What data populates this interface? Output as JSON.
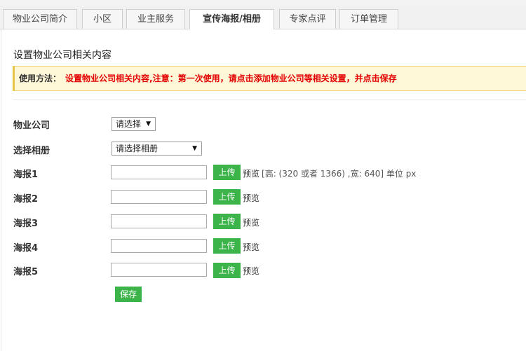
{
  "tabs": [
    {
      "label": "物业公司简介",
      "active": false
    },
    {
      "label": "小区",
      "active": false
    },
    {
      "label": "业主服务",
      "active": false
    },
    {
      "label": "宣传海报/相册",
      "active": true
    },
    {
      "label": "专家点评",
      "active": false
    },
    {
      "label": "订单管理",
      "active": false
    }
  ],
  "page": {
    "title": "设置物业公司相关内容",
    "notice_label": "使用方法：",
    "notice_text": "设置物业公司相关内容,注意：第一次使用，请点击添加物业公司等相关设置，并点击保存"
  },
  "form": {
    "company_label": "物业公司",
    "company_select": "请选择",
    "album_label": "选择相册",
    "album_select": "请选择相册",
    "posters": [
      {
        "label": "海报1",
        "value": "",
        "upload": "上传",
        "preview": "预览",
        "hint": "[高: (320 或者 1366) ,宽: 640] 单位 px"
      },
      {
        "label": "海报2",
        "value": "",
        "upload": "上传",
        "preview": "预览"
      },
      {
        "label": "海报3",
        "value": "",
        "upload": "上传",
        "preview": "预览"
      },
      {
        "label": "海报4",
        "value": "",
        "upload": "上传",
        "preview": "预览"
      },
      {
        "label": "海报5",
        "value": "",
        "upload": "上传",
        "preview": "预览"
      }
    ],
    "save": "保存"
  },
  "icons": {
    "dropdown": "caret-down-icon"
  },
  "colors": {
    "accent": "#3cb44a",
    "notice_bg": "#fff8d8",
    "notice_text": "#e30000"
  }
}
